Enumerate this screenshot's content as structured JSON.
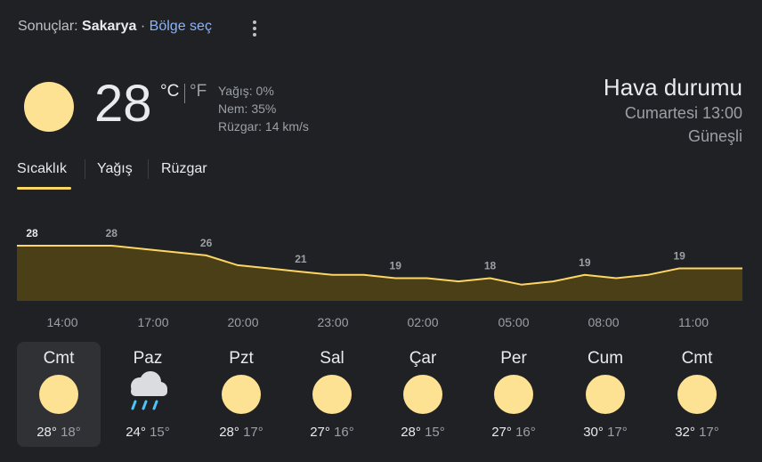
{
  "header": {
    "results_label": "Sonuçlar:",
    "location": "Sakarya",
    "separator": "·",
    "choose_region": "Bölge seç",
    "menu_icon": "more-vert-icon"
  },
  "current": {
    "icon": "sun-icon",
    "temperature": "28",
    "unit_c": "°C",
    "unit_f": "°F",
    "precipitation": "Yağış: 0%",
    "humidity": "Nem: 35%",
    "wind": "Rüzgar: 14 km/s"
  },
  "summary": {
    "title": "Hava durumu",
    "datetime": "Cumartesi 13:00",
    "condition": "Güneşli"
  },
  "tabs": [
    {
      "label": "Sıcaklık",
      "active": true
    },
    {
      "label": "Yağış",
      "active": false
    },
    {
      "label": "Rüzgar",
      "active": false
    }
  ],
  "chart_data": {
    "type": "area",
    "x": [
      "14:00",
      "15:00",
      "16:00",
      "17:00",
      "18:00",
      "19:00",
      "20:00",
      "21:00",
      "22:00",
      "23:00",
      "00:00",
      "01:00",
      "02:00",
      "03:00",
      "04:00",
      "05:00",
      "06:00",
      "07:00",
      "08:00",
      "09:00",
      "10:00",
      "11:00",
      "12:00",
      "13:00"
    ],
    "values": [
      28,
      28,
      28,
      28,
      27,
      26,
      25,
      22,
      21,
      20,
      19,
      19,
      18,
      18,
      17,
      18,
      16,
      17,
      19,
      18,
      19,
      21,
      21,
      21
    ],
    "labels": [
      {
        "index": 0,
        "text": "28"
      },
      {
        "index": 3,
        "text": "28"
      },
      {
        "index": 6,
        "text": "26"
      },
      {
        "index": 9,
        "text": "21"
      },
      {
        "index": 12,
        "text": "19"
      },
      {
        "index": 15,
        "text": "18"
      },
      {
        "index": 18,
        "text": "19"
      },
      {
        "index": 21,
        "text": "19"
      }
    ],
    "x_ticks": [
      "14:00",
      "17:00",
      "20:00",
      "23:00",
      "02:00",
      "05:00",
      "08:00",
      "11:00"
    ],
    "line_color": "#fdd663",
    "fill_color": "#4a3f16"
  },
  "forecast": [
    {
      "day": "Cmt",
      "icon": "sun-icon",
      "high": "28°",
      "low": "18°",
      "selected": true
    },
    {
      "day": "Paz",
      "icon": "rain-cloud-icon",
      "high": "24°",
      "low": "15°",
      "selected": false
    },
    {
      "day": "Pzt",
      "icon": "sun-icon",
      "high": "28°",
      "low": "17°",
      "selected": false
    },
    {
      "day": "Sal",
      "icon": "sun-icon",
      "high": "27°",
      "low": "16°",
      "selected": false
    },
    {
      "day": "Çar",
      "icon": "sun-icon",
      "high": "28°",
      "low": "15°",
      "selected": false
    },
    {
      "day": "Per",
      "icon": "sun-icon",
      "high": "27°",
      "low": "16°",
      "selected": false
    },
    {
      "day": "Cum",
      "icon": "sun-icon",
      "high": "30°",
      "low": "17°",
      "selected": false
    },
    {
      "day": "Cmt",
      "icon": "sun-icon",
      "high": "32°",
      "low": "17°",
      "selected": false
    }
  ]
}
